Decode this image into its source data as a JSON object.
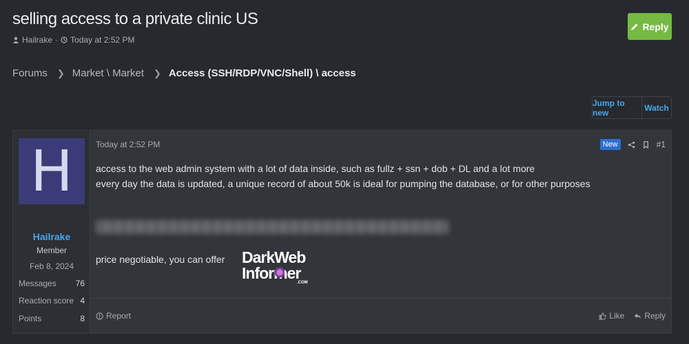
{
  "thread": {
    "title": "selling access to a private clinic US",
    "author": "Hailrake",
    "separator": "·",
    "time": "Today at 2:52 PM",
    "reply_label": "Reply"
  },
  "breadcrumb": {
    "items": [
      "Forums",
      "Market \\ Market"
    ],
    "current": "Access (SSH/RDP/VNC/Shell) \\ access"
  },
  "actions": {
    "jump_to_new": "Jump to new",
    "watch": "Watch"
  },
  "post": {
    "user": {
      "avatar_letter": "H",
      "name": "Hailrake",
      "title": "Member",
      "joined": "Feb 8, 2024",
      "stats": [
        {
          "label": "Messages",
          "value": "76"
        },
        {
          "label": "Reaction score",
          "value": "4"
        },
        {
          "label": "Points",
          "value": "8"
        }
      ]
    },
    "date": "Today at 2:52 PM",
    "badge": "New",
    "number": "#1",
    "lines": [
      "access to the web admin system with a lot of data inside, such as fullz + ssn + dob + DL and a lot more",
      "every day the data is updated, a unique record of about 50k is ideal for pumping the database, or for other purposes"
    ],
    "price_text": "price negotiable, you can offer",
    "logo": {
      "line1": "DarkWeb",
      "line2": "Informer",
      "suffix": ".COM"
    },
    "report": "Report",
    "like": "Like",
    "reply": "Reply"
  },
  "colors": {
    "background": "#26292d",
    "accent_green": "#75ba43",
    "link_blue": "#47a7eb",
    "badge_blue": "#2d6ecf",
    "avatar_bg": "#3b3b79"
  }
}
